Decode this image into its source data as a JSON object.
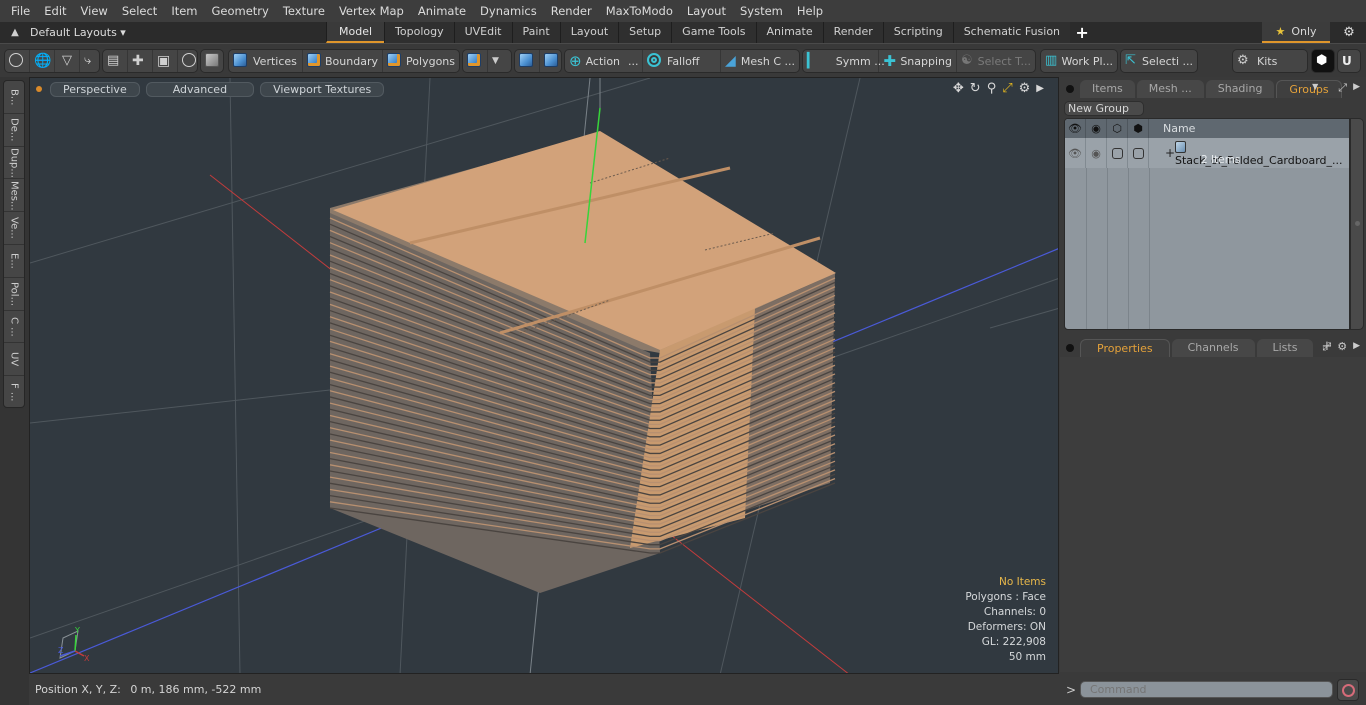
{
  "menu": [
    "File",
    "Edit",
    "View",
    "Select",
    "Item",
    "Geometry",
    "Texture",
    "Vertex Map",
    "Animate",
    "Dynamics",
    "Render",
    "MaxToModo",
    "Layout",
    "System",
    "Help"
  ],
  "layouts": {
    "selector_label": "Default Layouts ▾",
    "tabs": [
      "Model",
      "Topology",
      "UVEdit",
      "Paint",
      "Layout",
      "Setup",
      "Game Tools",
      "Animate",
      "Render",
      "Scripting",
      "Schematic Fusion"
    ],
    "active_tab": "Model",
    "add_label": "+",
    "only_label": "Only"
  },
  "toolbar": {
    "vertices": "Vertices",
    "boundary": "Boundary",
    "polygons": "Polygons",
    "action": "Action",
    "action_more": "...",
    "falloff": "Falloff",
    "mesh": "Mesh C ...",
    "symm": "Symm ...",
    "snapping": "Snapping",
    "select_t": "Select T...",
    "workplane": "Work Pl...",
    "selection": "Selecti ...",
    "kits": "Kits"
  },
  "left_tabs": [
    "B...",
    "De...",
    "Dup...",
    "Mes...",
    "Ve...",
    "E...",
    "Pol...",
    "C ...",
    "UV",
    "F ..."
  ],
  "viewport": {
    "view_mode": "Perspective",
    "shading": "Advanced",
    "textures": "Viewport Textures",
    "stats": {
      "selection": "No Items",
      "polygons": "Polygons : Face",
      "channels": "Channels: 0",
      "deformers": "Deformers: ON",
      "gl": "GL: 222,908",
      "grid": "50 mm"
    },
    "axis_labels": {
      "x": "X",
      "y": "Y",
      "z": "Z"
    }
  },
  "status": {
    "position_label": "Position X, Y, Z:",
    "position_value": "0 m, 186 mm, -522 mm"
  },
  "right_panel": {
    "top_tabs": [
      "Items",
      "Mesh ...",
      "Shading",
      "Groups"
    ],
    "top_active": "Groups",
    "new_group": "New Group",
    "column_name": "Name",
    "groups": [
      {
        "name": "Stack_of_Folded_Cardboard_...",
        "count": "2 Items"
      }
    ],
    "bottom_tabs": [
      "Properties",
      "Channels",
      "Lists"
    ],
    "bottom_active": "Properties",
    "add_tab": "+"
  },
  "command": {
    "prompt": ">",
    "placeholder": "Command"
  },
  "colors": {
    "accent": "#e0962b",
    "viewport_bg": "#313940",
    "cardboard": "#d2a27a",
    "axis_x": "#d23c3c",
    "axis_y": "#3cd23c",
    "axis_z": "#4a5ad8"
  }
}
